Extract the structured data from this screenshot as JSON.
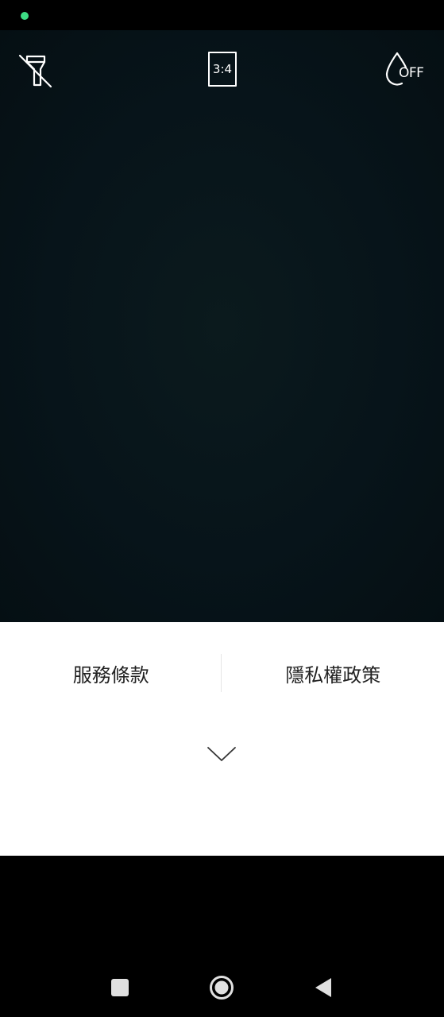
{
  "status_bar": {
    "indicator_color": "#3ddc84"
  },
  "camera": {
    "flash": {
      "icon": "flash-off-icon"
    },
    "aspect_ratio": {
      "label": "3:4"
    },
    "watermark": {
      "icon": "drop-icon",
      "label": "OFF"
    }
  },
  "panel": {
    "terms_label": "服務條款",
    "privacy_label": "隱私權政策",
    "collapse_icon": "chevron-down-icon"
  },
  "nav": {
    "recents_icon": "square-icon",
    "home_icon": "circle-icon",
    "back_icon": "triangle-left-icon"
  }
}
